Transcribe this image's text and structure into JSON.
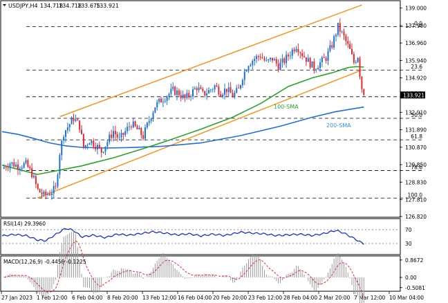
{
  "chart_data": {
    "type": "candlestick",
    "symbol_header": "USDJPY,H4",
    "ohlc_header": [
      "134.718",
      "134.718",
      "133.675",
      "133.921"
    ],
    "last_price": "133.921",
    "price_axis": {
      "min": 126.82,
      "max": 139.39,
      "ticks": [
        "139.000",
        "137.980",
        "136.960",
        "135.940",
        "134.920",
        "133.921",
        "132.910",
        "131.890",
        "130.870",
        "129.850",
        "128.830",
        "127.810",
        "126.820"
      ]
    },
    "x_tick_labels": [
      "27 Jan 2023",
      "1 Feb 12:00",
      "6 Feb 04:00",
      "8 Feb 20:00",
      "13 Feb 12:00",
      "16 Feb 04:00",
      "20 Feb 20:00",
      "23 Feb 12:00",
      "28 Feb 04:00",
      "2 Mar 20:00",
      "7 Mar 12:00",
      "10 Mar 04:00"
    ],
    "fib_levels": [
      {
        "label": "0.0",
        "price": 137.91
      },
      {
        "label": "23.6",
        "price": 135.38
      },
      {
        "label": "38.2",
        "price": 133.82
      },
      {
        "label": "50.0",
        "price": 132.56
      },
      {
        "label": "61.8",
        "price": 131.3
      },
      {
        "label": "78.6",
        "price": 129.51
      },
      {
        "label": "100.0",
        "price": 127.9
      }
    ],
    "channel": {
      "upper": [
        {
          "x": 0.146,
          "price": 132.66
        },
        {
          "x": 0.905,
          "price": 139.18
        }
      ],
      "lower": [
        {
          "x": 0.089,
          "price": 127.9
        },
        {
          "x": 0.905,
          "price": 135.38
        }
      ]
    },
    "annotations": [
      {
        "text": "100-SMA",
        "color": "#2e9e2e"
      },
      {
        "text": "200-SMA",
        "color": "#3b8ee0"
      }
    ],
    "sma_100": [
      [
        0.0,
        129.82
      ],
      [
        0.05,
        129.52
      ],
      [
        0.089,
        129.28
      ],
      [
        0.12,
        129.42
      ],
      [
        0.2,
        129.78
      ],
      [
        0.28,
        130.25
      ],
      [
        0.36,
        130.82
      ],
      [
        0.42,
        131.28
      ],
      [
        0.5,
        131.92
      ],
      [
        0.58,
        132.62
      ],
      [
        0.65,
        133.42
      ],
      [
        0.72,
        134.42
      ],
      [
        0.78,
        134.92
      ],
      [
        0.83,
        135.22
      ],
      [
        0.87,
        135.52
      ],
      [
        0.89,
        135.58
      ],
      [
        0.91,
        135.55
      ]
    ],
    "sma_200": [
      [
        0.0,
        131.78
      ],
      [
        0.04,
        131.62
      ],
      [
        0.08,
        131.38
      ],
      [
        0.12,
        131.12
      ],
      [
        0.16,
        130.95
      ],
      [
        0.2,
        130.86
      ],
      [
        0.26,
        130.82
      ],
      [
        0.32,
        130.85
      ],
      [
        0.4,
        130.92
      ],
      [
        0.5,
        131.12
      ],
      [
        0.6,
        131.55
      ],
      [
        0.7,
        132.1
      ],
      [
        0.78,
        132.62
      ],
      [
        0.84,
        132.95
      ],
      [
        0.91,
        133.22
      ]
    ],
    "price_path": [
      [
        0.0,
        129.62
      ],
      [
        0.02,
        129.95
      ],
      [
        0.04,
        129.78
      ],
      [
        0.06,
        129.88
      ],
      [
        0.075,
        129.32
      ],
      [
        0.09,
        128.35
      ],
      [
        0.105,
        128.05
      ],
      [
        0.12,
        128.2
      ],
      [
        0.135,
        128.45
      ],
      [
        0.145,
        130.55
      ],
      [
        0.155,
        131.72
      ],
      [
        0.165,
        132.05
      ],
      [
        0.18,
        132.58
      ],
      [
        0.195,
        132.1
      ],
      [
        0.205,
        130.85
      ],
      [
        0.22,
        131.28
      ],
      [
        0.235,
        131.0
      ],
      [
        0.25,
        130.62
      ],
      [
        0.265,
        131.2
      ],
      [
        0.28,
        131.82
      ],
      [
        0.295,
        131.3
      ],
      [
        0.31,
        131.78
      ],
      [
        0.325,
        132.25
      ],
      [
        0.34,
        131.9
      ],
      [
        0.355,
        131.5
      ],
      [
        0.37,
        132.45
      ],
      [
        0.385,
        133.28
      ],
      [
        0.4,
        133.62
      ],
      [
        0.415,
        133.9
      ],
      [
        0.43,
        134.18
      ],
      [
        0.445,
        134.02
      ],
      [
        0.46,
        133.7
      ],
      [
        0.475,
        134.02
      ],
      [
        0.49,
        134.38
      ],
      [
        0.505,
        133.96
      ],
      [
        0.52,
        134.15
      ],
      [
        0.535,
        134.45
      ],
      [
        0.55,
        134.1
      ],
      [
        0.565,
        134.25
      ],
      [
        0.58,
        133.88
      ],
      [
        0.595,
        134.22
      ],
      [
        0.605,
        135.02
      ],
      [
        0.62,
        135.78
      ],
      [
        0.635,
        136.05
      ],
      [
        0.65,
        136.22
      ],
      [
        0.665,
        135.8
      ],
      [
        0.68,
        136.05
      ],
      [
        0.695,
        135.62
      ],
      [
        0.71,
        135.92
      ],
      [
        0.725,
        136.38
      ],
      [
        0.74,
        136.82
      ],
      [
        0.755,
        136.32
      ],
      [
        0.77,
        135.9
      ],
      [
        0.785,
        135.5
      ],
      [
        0.8,
        135.8
      ],
      [
        0.815,
        136.1
      ],
      [
        0.83,
        136.85
      ],
      [
        0.845,
        137.91
      ],
      [
        0.86,
        137.3
      ],
      [
        0.875,
        136.52
      ],
      [
        0.885,
        135.82
      ],
      [
        0.895,
        136.22
      ],
      [
        0.903,
        134.52
      ],
      [
        0.91,
        133.921
      ]
    ],
    "rsi": {
      "label": "RSI(14) 29.3960",
      "levels": [
        "70",
        "30"
      ],
      "path": [
        [
          0.0,
          52
        ],
        [
          0.03,
          56
        ],
        [
          0.06,
          53
        ],
        [
          0.09,
          40
        ],
        [
          0.11,
          38
        ],
        [
          0.14,
          60
        ],
        [
          0.16,
          74
        ],
        [
          0.18,
          68
        ],
        [
          0.2,
          49
        ],
        [
          0.23,
          54
        ],
        [
          0.26,
          47
        ],
        [
          0.29,
          57
        ],
        [
          0.32,
          54
        ],
        [
          0.35,
          59
        ],
        [
          0.38,
          64
        ],
        [
          0.41,
          60
        ],
        [
          0.44,
          55
        ],
        [
          0.47,
          58
        ],
        [
          0.5,
          52
        ],
        [
          0.53,
          57
        ],
        [
          0.56,
          53
        ],
        [
          0.6,
          63
        ],
        [
          0.63,
          60
        ],
        [
          0.66,
          58
        ],
        [
          0.69,
          53
        ],
        [
          0.72,
          55
        ],
        [
          0.75,
          57
        ],
        [
          0.78,
          53
        ],
        [
          0.81,
          59
        ],
        [
          0.84,
          68
        ],
        [
          0.86,
          60
        ],
        [
          0.88,
          48
        ],
        [
          0.9,
          35
        ],
        [
          0.91,
          29.4
        ]
      ]
    },
    "macd": {
      "label": "MACD(12,26,9) -0.4456 -0.1225",
      "ticks": [
        "0.8672",
        "0.00",
        "-0.5081"
      ],
      "range": [
        -0.62,
        1.0
      ]
    }
  }
}
